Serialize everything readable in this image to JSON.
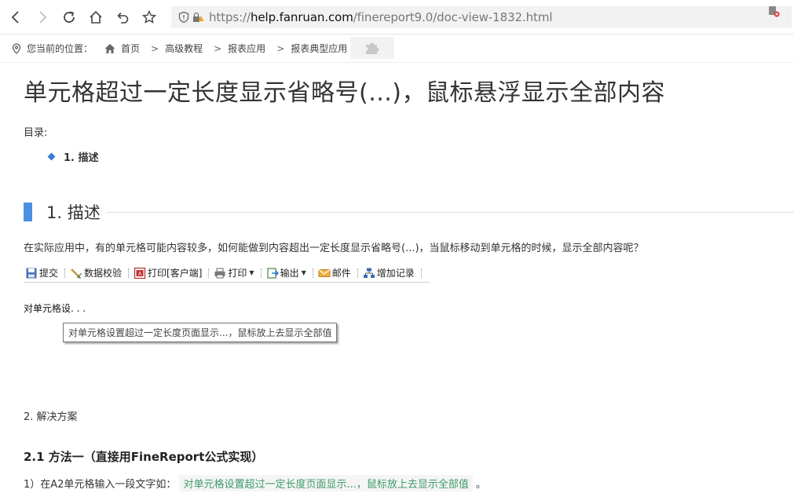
{
  "browser": {
    "url_prefix": "https://",
    "url_host": "help.fanruan.com",
    "url_path": "/finereport9.0/doc-view-1832.html"
  },
  "breadcrumb": {
    "label": "您当前的位置：",
    "items": [
      "首页",
      "高级教程",
      "报表应用",
      "报表典型应用"
    ],
    "separator": ">"
  },
  "article": {
    "title": "单元格超过一定长度显示省略号(...)，鼠标悬浮显示全部内容",
    "toc_label": "目录:",
    "toc_items": [
      "1. 描述"
    ],
    "section1_title": "1. 描述",
    "section1_paragraph": "在实际应用中，有的单元格可能内容较多，如何能做到内容超出一定长度显示省略号(...)，当鼠标移动到单元格的时候，显示全部内容呢？",
    "cell_preview_text": "对单元格设. . .",
    "tooltip_text": "对单元格设置超过一定长度页面显示...，鼠标放上去显示全部值",
    "section2_title": "2. 解决方案",
    "method1_title": "2.1 方法一（直接用FineReport公式实现）",
    "step1_prefix": "1）在A2单元格输入一段文字如：",
    "step1_code": "对单元格设置超过一定长度页面显示...，鼠标放上去显示全部值",
    "step1_suffix": "。"
  },
  "report_toolbar": {
    "submit": "提交",
    "validate": "数据校验",
    "print_client": "打印[客户端]",
    "print": "打印",
    "export": "输出",
    "email": "邮件",
    "add_record": "增加记录"
  },
  "colors": {
    "accent": "#4a90e2",
    "code_text": "#3c9a6b"
  }
}
